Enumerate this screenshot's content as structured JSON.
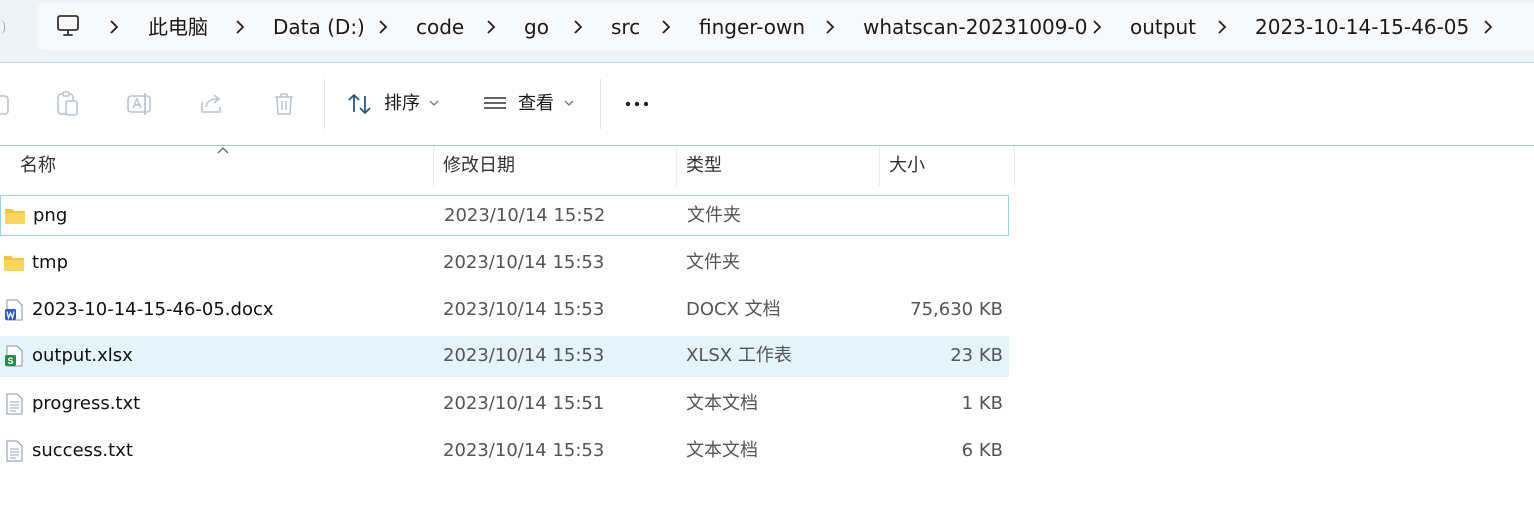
{
  "breadcrumb": {
    "items": [
      "此电脑",
      "Data (D:)",
      "code",
      "go",
      "src",
      "finger-own",
      "whatscan-20231009-0",
      "output",
      "2023-10-14-15-46-05"
    ]
  },
  "toolbar": {
    "sort_label": "排序",
    "view_label": "查看"
  },
  "columns": {
    "name": "名称",
    "date": "修改日期",
    "type": "类型",
    "size": "大小"
  },
  "files": [
    {
      "name": "png",
      "date": "2023/10/14 15:52",
      "type": "文件夹",
      "size": "",
      "icon": "folder-icon"
    },
    {
      "name": "tmp",
      "date": "2023/10/14 15:53",
      "type": "文件夹",
      "size": "",
      "icon": "folder-icon"
    },
    {
      "name": "2023-10-14-15-46-05.docx",
      "date": "2023/10/14 15:53",
      "type": "DOCX 文档",
      "size": "75,630 KB",
      "icon": "word-doc-icon"
    },
    {
      "name": "output.xlsx",
      "date": "2023/10/14 15:53",
      "type": "XLSX 工作表",
      "size": "23 KB",
      "icon": "excel-sheet-icon"
    },
    {
      "name": "progress.txt",
      "date": "2023/10/14 15:51",
      "type": "文本文档",
      "size": "1 KB",
      "icon": "text-file-icon"
    },
    {
      "name": "success.txt",
      "date": "2023/10/14 15:53",
      "type": "文本文档",
      "size": "6 KB",
      "icon": "text-file-icon"
    }
  ],
  "colors": {
    "hover_row": "#e5f3fb",
    "selected_border": "#99d4e4",
    "folder": "#f5c342",
    "word": "#2b5ccf",
    "excel": "#1f8f4e"
  }
}
